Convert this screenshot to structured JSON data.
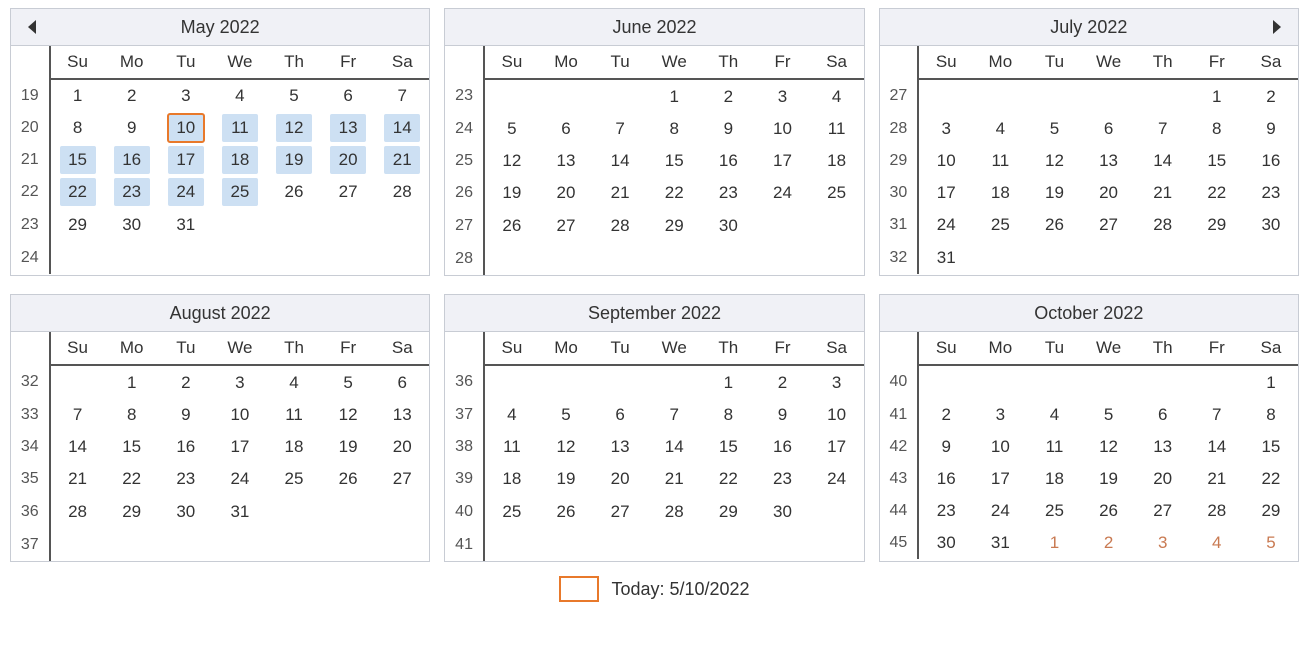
{
  "dow": [
    "Su",
    "Mo",
    "Tu",
    "We",
    "Th",
    "Fr",
    "Sa"
  ],
  "footer": {
    "label": "Today: 5/10/2022"
  },
  "months": [
    {
      "title": "May  2022",
      "nav": "prev",
      "weeks": [
        {
          "wk": "19",
          "days": [
            {
              "n": "1"
            },
            {
              "n": "2"
            },
            {
              "n": "3"
            },
            {
              "n": "4"
            },
            {
              "n": "5"
            },
            {
              "n": "6"
            },
            {
              "n": "7"
            }
          ]
        },
        {
          "wk": "20",
          "days": [
            {
              "n": "8"
            },
            {
              "n": "9"
            },
            {
              "n": "10",
              "today": true,
              "sel": true
            },
            {
              "n": "11",
              "sel": true
            },
            {
              "n": "12",
              "sel": true
            },
            {
              "n": "13",
              "sel": true
            },
            {
              "n": "14",
              "sel": true
            }
          ]
        },
        {
          "wk": "21",
          "days": [
            {
              "n": "15",
              "sel": true
            },
            {
              "n": "16",
              "sel": true
            },
            {
              "n": "17",
              "sel": true
            },
            {
              "n": "18",
              "sel": true
            },
            {
              "n": "19",
              "sel": true
            },
            {
              "n": "20",
              "sel": true
            },
            {
              "n": "21",
              "sel": true
            }
          ]
        },
        {
          "wk": "22",
          "days": [
            {
              "n": "22",
              "sel": true
            },
            {
              "n": "23",
              "sel": true
            },
            {
              "n": "24",
              "sel": true
            },
            {
              "n": "25",
              "sel": true
            },
            {
              "n": "26"
            },
            {
              "n": "27"
            },
            {
              "n": "28"
            }
          ]
        },
        {
          "wk": "23",
          "days": [
            {
              "n": "29"
            },
            {
              "n": "30"
            },
            {
              "n": "31"
            },
            {
              "n": ""
            },
            {
              "n": ""
            },
            {
              "n": ""
            },
            {
              "n": ""
            }
          ]
        },
        {
          "wk": "24",
          "days": [
            {
              "n": ""
            },
            {
              "n": ""
            },
            {
              "n": ""
            },
            {
              "n": ""
            },
            {
              "n": ""
            },
            {
              "n": ""
            },
            {
              "n": ""
            }
          ]
        }
      ]
    },
    {
      "title": "June  2022",
      "weeks": [
        {
          "wk": "23",
          "days": [
            {
              "n": ""
            },
            {
              "n": ""
            },
            {
              "n": ""
            },
            {
              "n": "1"
            },
            {
              "n": "2"
            },
            {
              "n": "3"
            },
            {
              "n": "4"
            }
          ]
        },
        {
          "wk": "24",
          "days": [
            {
              "n": "5"
            },
            {
              "n": "6"
            },
            {
              "n": "7"
            },
            {
              "n": "8"
            },
            {
              "n": "9"
            },
            {
              "n": "10"
            },
            {
              "n": "11"
            }
          ]
        },
        {
          "wk": "25",
          "days": [
            {
              "n": "12"
            },
            {
              "n": "13"
            },
            {
              "n": "14"
            },
            {
              "n": "15"
            },
            {
              "n": "16"
            },
            {
              "n": "17"
            },
            {
              "n": "18"
            }
          ]
        },
        {
          "wk": "26",
          "days": [
            {
              "n": "19"
            },
            {
              "n": "20"
            },
            {
              "n": "21"
            },
            {
              "n": "22"
            },
            {
              "n": "23"
            },
            {
              "n": "24"
            },
            {
              "n": "25"
            }
          ]
        },
        {
          "wk": "27",
          "days": [
            {
              "n": "26"
            },
            {
              "n": "27"
            },
            {
              "n": "28"
            },
            {
              "n": "29"
            },
            {
              "n": "30"
            },
            {
              "n": ""
            },
            {
              "n": ""
            }
          ]
        },
        {
          "wk": "28",
          "days": [
            {
              "n": ""
            },
            {
              "n": ""
            },
            {
              "n": ""
            },
            {
              "n": ""
            },
            {
              "n": ""
            },
            {
              "n": ""
            },
            {
              "n": ""
            }
          ]
        }
      ]
    },
    {
      "title": "July  2022",
      "nav": "next",
      "weeks": [
        {
          "wk": "27",
          "days": [
            {
              "n": ""
            },
            {
              "n": ""
            },
            {
              "n": ""
            },
            {
              "n": ""
            },
            {
              "n": ""
            },
            {
              "n": "1"
            },
            {
              "n": "2"
            }
          ]
        },
        {
          "wk": "28",
          "days": [
            {
              "n": "3"
            },
            {
              "n": "4"
            },
            {
              "n": "5"
            },
            {
              "n": "6"
            },
            {
              "n": "7"
            },
            {
              "n": "8"
            },
            {
              "n": "9"
            }
          ]
        },
        {
          "wk": "29",
          "days": [
            {
              "n": "10"
            },
            {
              "n": "11"
            },
            {
              "n": "12"
            },
            {
              "n": "13"
            },
            {
              "n": "14"
            },
            {
              "n": "15"
            },
            {
              "n": "16"
            }
          ]
        },
        {
          "wk": "30",
          "days": [
            {
              "n": "17"
            },
            {
              "n": "18"
            },
            {
              "n": "19"
            },
            {
              "n": "20"
            },
            {
              "n": "21"
            },
            {
              "n": "22"
            },
            {
              "n": "23"
            }
          ]
        },
        {
          "wk": "31",
          "days": [
            {
              "n": "24"
            },
            {
              "n": "25"
            },
            {
              "n": "26"
            },
            {
              "n": "27"
            },
            {
              "n": "28"
            },
            {
              "n": "29"
            },
            {
              "n": "30"
            }
          ]
        },
        {
          "wk": "32",
          "days": [
            {
              "n": "31"
            },
            {
              "n": ""
            },
            {
              "n": ""
            },
            {
              "n": ""
            },
            {
              "n": ""
            },
            {
              "n": ""
            },
            {
              "n": ""
            }
          ]
        }
      ]
    },
    {
      "title": "August  2022",
      "weeks": [
        {
          "wk": "32",
          "days": [
            {
              "n": ""
            },
            {
              "n": "1"
            },
            {
              "n": "2"
            },
            {
              "n": "3"
            },
            {
              "n": "4"
            },
            {
              "n": "5"
            },
            {
              "n": "6"
            }
          ]
        },
        {
          "wk": "33",
          "days": [
            {
              "n": "7"
            },
            {
              "n": "8"
            },
            {
              "n": "9"
            },
            {
              "n": "10"
            },
            {
              "n": "11"
            },
            {
              "n": "12"
            },
            {
              "n": "13"
            }
          ]
        },
        {
          "wk": "34",
          "days": [
            {
              "n": "14"
            },
            {
              "n": "15"
            },
            {
              "n": "16"
            },
            {
              "n": "17"
            },
            {
              "n": "18"
            },
            {
              "n": "19"
            },
            {
              "n": "20"
            }
          ]
        },
        {
          "wk": "35",
          "days": [
            {
              "n": "21"
            },
            {
              "n": "22"
            },
            {
              "n": "23"
            },
            {
              "n": "24"
            },
            {
              "n": "25"
            },
            {
              "n": "26"
            },
            {
              "n": "27"
            }
          ]
        },
        {
          "wk": "36",
          "days": [
            {
              "n": "28"
            },
            {
              "n": "29"
            },
            {
              "n": "30"
            },
            {
              "n": "31"
            },
            {
              "n": ""
            },
            {
              "n": ""
            },
            {
              "n": ""
            }
          ]
        },
        {
          "wk": "37",
          "days": [
            {
              "n": ""
            },
            {
              "n": ""
            },
            {
              "n": ""
            },
            {
              "n": ""
            },
            {
              "n": ""
            },
            {
              "n": ""
            },
            {
              "n": ""
            }
          ]
        }
      ]
    },
    {
      "title": "September  2022",
      "weeks": [
        {
          "wk": "36",
          "days": [
            {
              "n": ""
            },
            {
              "n": ""
            },
            {
              "n": ""
            },
            {
              "n": ""
            },
            {
              "n": "1"
            },
            {
              "n": "2"
            },
            {
              "n": "3"
            }
          ]
        },
        {
          "wk": "37",
          "days": [
            {
              "n": "4"
            },
            {
              "n": "5"
            },
            {
              "n": "6"
            },
            {
              "n": "7"
            },
            {
              "n": "8"
            },
            {
              "n": "9"
            },
            {
              "n": "10"
            }
          ]
        },
        {
          "wk": "38",
          "days": [
            {
              "n": "11"
            },
            {
              "n": "12"
            },
            {
              "n": "13"
            },
            {
              "n": "14"
            },
            {
              "n": "15"
            },
            {
              "n": "16"
            },
            {
              "n": "17"
            }
          ]
        },
        {
          "wk": "39",
          "days": [
            {
              "n": "18"
            },
            {
              "n": "19"
            },
            {
              "n": "20"
            },
            {
              "n": "21"
            },
            {
              "n": "22"
            },
            {
              "n": "23"
            },
            {
              "n": "24"
            }
          ]
        },
        {
          "wk": "40",
          "days": [
            {
              "n": "25"
            },
            {
              "n": "26"
            },
            {
              "n": "27"
            },
            {
              "n": "28"
            },
            {
              "n": "29"
            },
            {
              "n": "30"
            },
            {
              "n": ""
            }
          ]
        },
        {
          "wk": "41",
          "days": [
            {
              "n": ""
            },
            {
              "n": ""
            },
            {
              "n": ""
            },
            {
              "n": ""
            },
            {
              "n": ""
            },
            {
              "n": ""
            },
            {
              "n": ""
            }
          ]
        }
      ]
    },
    {
      "title": "October  2022",
      "weeks": [
        {
          "wk": "40",
          "days": [
            {
              "n": ""
            },
            {
              "n": ""
            },
            {
              "n": ""
            },
            {
              "n": ""
            },
            {
              "n": ""
            },
            {
              "n": ""
            },
            {
              "n": "1"
            }
          ]
        },
        {
          "wk": "41",
          "days": [
            {
              "n": "2"
            },
            {
              "n": "3"
            },
            {
              "n": "4"
            },
            {
              "n": "5"
            },
            {
              "n": "6"
            },
            {
              "n": "7"
            },
            {
              "n": "8"
            }
          ]
        },
        {
          "wk": "42",
          "days": [
            {
              "n": "9"
            },
            {
              "n": "10"
            },
            {
              "n": "11"
            },
            {
              "n": "12"
            },
            {
              "n": "13"
            },
            {
              "n": "14"
            },
            {
              "n": "15"
            }
          ]
        },
        {
          "wk": "43",
          "days": [
            {
              "n": "16"
            },
            {
              "n": "17"
            },
            {
              "n": "18"
            },
            {
              "n": "19"
            },
            {
              "n": "20"
            },
            {
              "n": "21"
            },
            {
              "n": "22"
            }
          ]
        },
        {
          "wk": "44",
          "days": [
            {
              "n": "23"
            },
            {
              "n": "24"
            },
            {
              "n": "25"
            },
            {
              "n": "26"
            },
            {
              "n": "27"
            },
            {
              "n": "28"
            },
            {
              "n": "29"
            }
          ]
        },
        {
          "wk": "45",
          "days": [
            {
              "n": "30"
            },
            {
              "n": "31"
            },
            {
              "n": "1",
              "other": true
            },
            {
              "n": "2",
              "other": true
            },
            {
              "n": "3",
              "other": true
            },
            {
              "n": "4",
              "other": true
            },
            {
              "n": "5",
              "other": true
            }
          ]
        }
      ]
    }
  ]
}
